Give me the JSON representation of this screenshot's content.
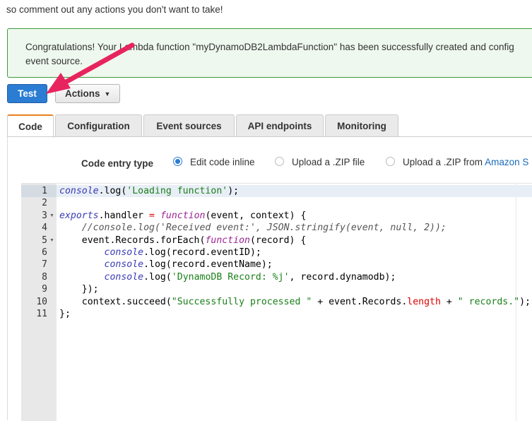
{
  "intro_text": "so comment out any actions you don't want to take!",
  "alert": {
    "line1": "Congratulations! Your Lambda function \"myDynamoDB2LambdaFunction\" has been successfully created and config",
    "line2": "event source."
  },
  "toolbar": {
    "test_label": "Test",
    "actions_label": "Actions"
  },
  "tabs": [
    {
      "label": "Code"
    },
    {
      "label": "Configuration"
    },
    {
      "label": "Event sources"
    },
    {
      "label": "API endpoints"
    },
    {
      "label": "Monitoring"
    }
  ],
  "code_entry": {
    "label": "Code entry type",
    "options": [
      {
        "label": "Edit code inline",
        "selected": true
      },
      {
        "label": "Upload a .ZIP file",
        "selected": false
      },
      {
        "label": "Upload a .ZIP from ",
        "link": "Amazon S",
        "selected": false
      }
    ]
  },
  "editor": {
    "line_numbers": [
      "1",
      "2",
      "3",
      "4",
      "5",
      "6",
      "7",
      "8",
      "9",
      "10",
      "11"
    ],
    "lines": {
      "l1": {
        "a": "console",
        "b": ".log(",
        "c": "'Loading function'",
        "d": ");"
      },
      "l3": {
        "a": "exports",
        "b": ".handler ",
        "c": "=",
        "d": " ",
        "e": "function",
        "f": "(event, context) {"
      },
      "l4": {
        "a": "    //console.log('Received event:', JSON.stringify(event, null, 2));"
      },
      "l5": {
        "a": "    event.Records.forEach(",
        "b": "function",
        "c": "(record) {"
      },
      "l6": {
        "a": "        ",
        "b": "console",
        "c": ".log(record.eventID);"
      },
      "l7": {
        "a": "        ",
        "b": "console",
        "c": ".log(record.eventName);"
      },
      "l8": {
        "a": "        ",
        "b": "console",
        "c": ".log(",
        "d": "'DynamoDB Record: %j'",
        "e": ", record.dynamodb);"
      },
      "l9": {
        "a": "    });"
      },
      "l10": {
        "a": "    context.succeed(",
        "b": "\"Successfully processed \"",
        "c": " + event.Records.",
        "d": "length",
        "e": " + ",
        "f": "\" records.\"",
        "g": ");"
      },
      "l11": {
        "a": "};"
      }
    }
  },
  "colors": {
    "primary": "#2b7cd3",
    "tab_accent": "#e8821e",
    "annotation_arrow": "#e8245e",
    "success_border": "#3c9a3c"
  },
  "annotation": {
    "icon": "pink-arrow-icon"
  }
}
